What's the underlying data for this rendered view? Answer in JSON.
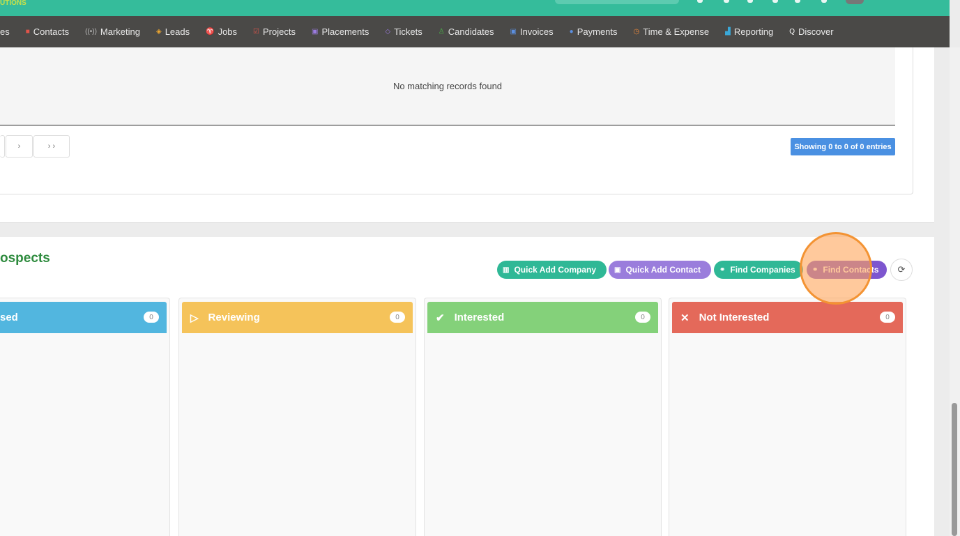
{
  "header": {
    "logo_text": "UTIONS"
  },
  "nav": [
    {
      "label": "es",
      "icon": "companies-icon",
      "color": "#e8e8e8",
      "glyph": ""
    },
    {
      "label": "Contacts",
      "icon": "contacts-icon",
      "color": "#e0544a",
      "glyph": "■"
    },
    {
      "label": "Marketing",
      "icon": "broadcast-icon",
      "color": "#bbbbbb",
      "glyph": "((•))"
    },
    {
      "label": "Leads",
      "icon": "target-icon",
      "color": "#f0a830",
      "glyph": "◈"
    },
    {
      "label": "Jobs",
      "icon": "trophy-icon",
      "color": "#3aa8d8",
      "glyph": "♈"
    },
    {
      "label": "Projects",
      "icon": "checkbox-icon",
      "color": "#e0544a",
      "glyph": "☑"
    },
    {
      "label": "Placements",
      "icon": "briefcase-icon",
      "color": "#9b7be0",
      "glyph": "▣"
    },
    {
      "label": "Tickets",
      "icon": "tag-icon",
      "color": "#9b7be0",
      "glyph": "◇"
    },
    {
      "label": "Candidates",
      "icon": "users-icon",
      "color": "#4ab84a",
      "glyph": "♙"
    },
    {
      "label": "Invoices",
      "icon": "invoice-icon",
      "color": "#5b8fe0",
      "glyph": "▣"
    },
    {
      "label": "Payments",
      "icon": "coin-icon",
      "color": "#5b8fe0",
      "glyph": "●"
    },
    {
      "label": "Time & Expense",
      "icon": "clock-icon",
      "color": "#f08a3a",
      "glyph": "◷"
    },
    {
      "label": "Reporting",
      "icon": "bar-chart-icon",
      "color": "#3aa8d8",
      "glyph": "▟"
    },
    {
      "label": "Discover",
      "icon": "search-icon",
      "color": "#ffffff",
      "glyph": "Q"
    }
  ],
  "table": {
    "empty_text": "No matching records found",
    "next": "›",
    "last": "› ›",
    "showing": "Showing 0 to 0 of 0 entries"
  },
  "prospects": {
    "title": "ospects",
    "buttons": [
      {
        "label": "Quick Add Company",
        "icon": "building-icon",
        "glyph": "▥",
        "color": "#2fb896"
      },
      {
        "label": "Quick Add Contact",
        "icon": "contact-card-icon",
        "glyph": "▣",
        "color": "#9a7ddc"
      },
      {
        "label": "Find Companies",
        "icon": "link-icon",
        "glyph": "⚭",
        "color": "#2fb896"
      },
      {
        "label": "Find Contacts",
        "icon": "link-icon",
        "glyph": "⚭",
        "color": "#7d56cf"
      }
    ],
    "refresh_glyph": "⟳",
    "columns": [
      {
        "label": "sed",
        "count": "0",
        "color": "#52b6df",
        "glyph": "",
        "icon": ""
      },
      {
        "label": "Reviewing",
        "count": "0",
        "color": "#f5c35a",
        "glyph": "▷",
        "icon": "play-icon"
      },
      {
        "label": "Interested",
        "count": "0",
        "color": "#84d17a",
        "glyph": "✔",
        "icon": "check-icon"
      },
      {
        "label": "Not Interested",
        "count": "0",
        "color": "#e4695a",
        "glyph": "✕",
        "icon": "x-icon"
      }
    ]
  }
}
